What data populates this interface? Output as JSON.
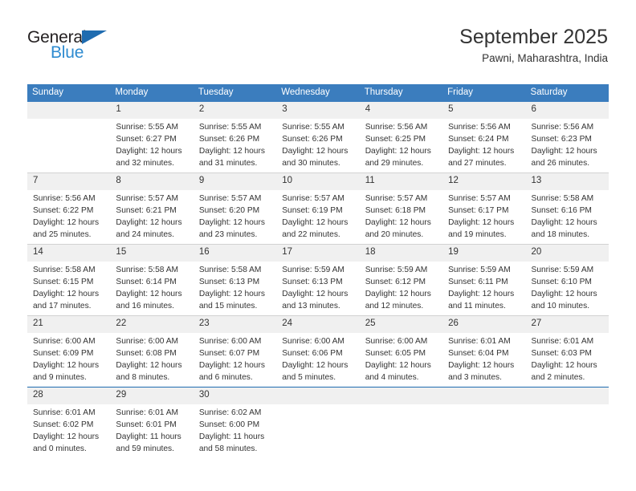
{
  "brand": {
    "name_part1": "General",
    "name_part2": "Blue",
    "color_dark": "#231f20",
    "color_blue": "#2e8bd0",
    "triangle_color": "#1f6cb0"
  },
  "header": {
    "title": "September 2025",
    "subtitle": "Pawni, Maharashtra, India"
  },
  "theme": {
    "header_bg": "#3b7dbe",
    "daynum_bg": "#f0f0f0",
    "text": "#333333",
    "separator": "#d2d2d2",
    "accent_rule": "#1f6cb0"
  },
  "weekdays": [
    "Sunday",
    "Monday",
    "Tuesday",
    "Wednesday",
    "Thursday",
    "Friday",
    "Saturday"
  ],
  "weeks": [
    {
      "accent": false,
      "days": [
        {
          "num": "",
          "lines": []
        },
        {
          "num": "1",
          "lines": [
            "Sunrise: 5:55 AM",
            "Sunset: 6:27 PM",
            "Daylight: 12 hours",
            "and 32 minutes."
          ]
        },
        {
          "num": "2",
          "lines": [
            "Sunrise: 5:55 AM",
            "Sunset: 6:26 PM",
            "Daylight: 12 hours",
            "and 31 minutes."
          ]
        },
        {
          "num": "3",
          "lines": [
            "Sunrise: 5:55 AM",
            "Sunset: 6:26 PM",
            "Daylight: 12 hours",
            "and 30 minutes."
          ]
        },
        {
          "num": "4",
          "lines": [
            "Sunrise: 5:56 AM",
            "Sunset: 6:25 PM",
            "Daylight: 12 hours",
            "and 29 minutes."
          ]
        },
        {
          "num": "5",
          "lines": [
            "Sunrise: 5:56 AM",
            "Sunset: 6:24 PM",
            "Daylight: 12 hours",
            "and 27 minutes."
          ]
        },
        {
          "num": "6",
          "lines": [
            "Sunrise: 5:56 AM",
            "Sunset: 6:23 PM",
            "Daylight: 12 hours",
            "and 26 minutes."
          ]
        }
      ]
    },
    {
      "accent": false,
      "days": [
        {
          "num": "7",
          "lines": [
            "Sunrise: 5:56 AM",
            "Sunset: 6:22 PM",
            "Daylight: 12 hours",
            "and 25 minutes."
          ]
        },
        {
          "num": "8",
          "lines": [
            "Sunrise: 5:57 AM",
            "Sunset: 6:21 PM",
            "Daylight: 12 hours",
            "and 24 minutes."
          ]
        },
        {
          "num": "9",
          "lines": [
            "Sunrise: 5:57 AM",
            "Sunset: 6:20 PM",
            "Daylight: 12 hours",
            "and 23 minutes."
          ]
        },
        {
          "num": "10",
          "lines": [
            "Sunrise: 5:57 AM",
            "Sunset: 6:19 PM",
            "Daylight: 12 hours",
            "and 22 minutes."
          ]
        },
        {
          "num": "11",
          "lines": [
            "Sunrise: 5:57 AM",
            "Sunset: 6:18 PM",
            "Daylight: 12 hours",
            "and 20 minutes."
          ]
        },
        {
          "num": "12",
          "lines": [
            "Sunrise: 5:57 AM",
            "Sunset: 6:17 PM",
            "Daylight: 12 hours",
            "and 19 minutes."
          ]
        },
        {
          "num": "13",
          "lines": [
            "Sunrise: 5:58 AM",
            "Sunset: 6:16 PM",
            "Daylight: 12 hours",
            "and 18 minutes."
          ]
        }
      ]
    },
    {
      "accent": false,
      "days": [
        {
          "num": "14",
          "lines": [
            "Sunrise: 5:58 AM",
            "Sunset: 6:15 PM",
            "Daylight: 12 hours",
            "and 17 minutes."
          ]
        },
        {
          "num": "15",
          "lines": [
            "Sunrise: 5:58 AM",
            "Sunset: 6:14 PM",
            "Daylight: 12 hours",
            "and 16 minutes."
          ]
        },
        {
          "num": "16",
          "lines": [
            "Sunrise: 5:58 AM",
            "Sunset: 6:13 PM",
            "Daylight: 12 hours",
            "and 15 minutes."
          ]
        },
        {
          "num": "17",
          "lines": [
            "Sunrise: 5:59 AM",
            "Sunset: 6:13 PM",
            "Daylight: 12 hours",
            "and 13 minutes."
          ]
        },
        {
          "num": "18",
          "lines": [
            "Sunrise: 5:59 AM",
            "Sunset: 6:12 PM",
            "Daylight: 12 hours",
            "and 12 minutes."
          ]
        },
        {
          "num": "19",
          "lines": [
            "Sunrise: 5:59 AM",
            "Sunset: 6:11 PM",
            "Daylight: 12 hours",
            "and 11 minutes."
          ]
        },
        {
          "num": "20",
          "lines": [
            "Sunrise: 5:59 AM",
            "Sunset: 6:10 PM",
            "Daylight: 12 hours",
            "and 10 minutes."
          ]
        }
      ]
    },
    {
      "accent": false,
      "days": [
        {
          "num": "21",
          "lines": [
            "Sunrise: 6:00 AM",
            "Sunset: 6:09 PM",
            "Daylight: 12 hours",
            "and 9 minutes."
          ]
        },
        {
          "num": "22",
          "lines": [
            "Sunrise: 6:00 AM",
            "Sunset: 6:08 PM",
            "Daylight: 12 hours",
            "and 8 minutes."
          ]
        },
        {
          "num": "23",
          "lines": [
            "Sunrise: 6:00 AM",
            "Sunset: 6:07 PM",
            "Daylight: 12 hours",
            "and 6 minutes."
          ]
        },
        {
          "num": "24",
          "lines": [
            "Sunrise: 6:00 AM",
            "Sunset: 6:06 PM",
            "Daylight: 12 hours",
            "and 5 minutes."
          ]
        },
        {
          "num": "25",
          "lines": [
            "Sunrise: 6:00 AM",
            "Sunset: 6:05 PM",
            "Daylight: 12 hours",
            "and 4 minutes."
          ]
        },
        {
          "num": "26",
          "lines": [
            "Sunrise: 6:01 AM",
            "Sunset: 6:04 PM",
            "Daylight: 12 hours",
            "and 3 minutes."
          ]
        },
        {
          "num": "27",
          "lines": [
            "Sunrise: 6:01 AM",
            "Sunset: 6:03 PM",
            "Daylight: 12 hours",
            "and 2 minutes."
          ]
        }
      ]
    },
    {
      "accent": true,
      "days": [
        {
          "num": "28",
          "lines": [
            "Sunrise: 6:01 AM",
            "Sunset: 6:02 PM",
            "Daylight: 12 hours",
            "and 0 minutes."
          ]
        },
        {
          "num": "29",
          "lines": [
            "Sunrise: 6:01 AM",
            "Sunset: 6:01 PM",
            "Daylight: 11 hours",
            "and 59 minutes."
          ]
        },
        {
          "num": "30",
          "lines": [
            "Sunrise: 6:02 AM",
            "Sunset: 6:00 PM",
            "Daylight: 11 hours",
            "and 58 minutes."
          ]
        },
        {
          "num": "",
          "lines": []
        },
        {
          "num": "",
          "lines": []
        },
        {
          "num": "",
          "lines": []
        },
        {
          "num": "",
          "lines": []
        }
      ]
    }
  ]
}
